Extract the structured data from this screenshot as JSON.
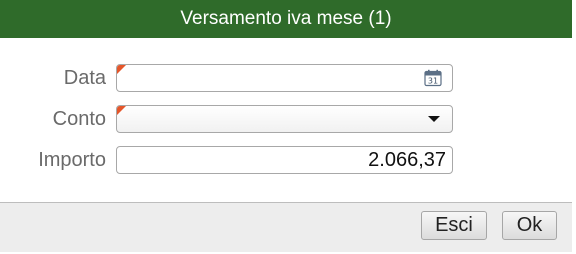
{
  "dialog": {
    "title": "Versamento iva mese (1)"
  },
  "form": {
    "data": {
      "label": "Data",
      "value": "",
      "icon": "calendar-icon",
      "required": true,
      "calendar_day": "31"
    },
    "conto": {
      "label": "Conto",
      "value": "",
      "icon": "chevron-down-icon",
      "required": true
    },
    "importo": {
      "label": "Importo",
      "value": "2.066,37"
    }
  },
  "buttons": {
    "esci": "Esci",
    "ok": "Ok"
  },
  "colors": {
    "titlebar": "#2f6b2a",
    "required_marker": "#e5562a",
    "label_text": "#6a6a6a",
    "footer": "#ededed"
  }
}
